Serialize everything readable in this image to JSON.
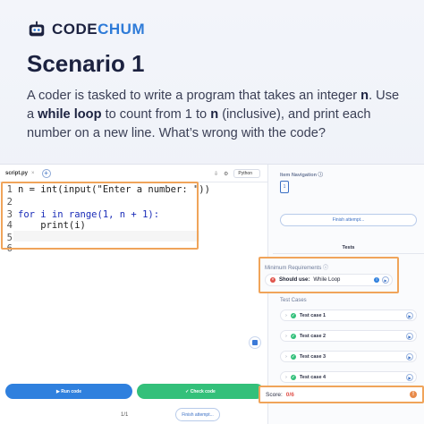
{
  "brand": {
    "name_part1": "CODE",
    "name_part2": "CHUM"
  },
  "headline": "Scenario 1",
  "description": {
    "p1": "A coder is tasked to write a program that takes an integer ",
    "b1": "n",
    "p2": ". Use a ",
    "b2": "while loop",
    "p3": " to count from 1 to ",
    "b3": "n",
    "p4": " (inclusive), and print each number on a new line. What’s wrong with the code?"
  },
  "editor": {
    "file_tab": "script.py",
    "close_glyph": "×",
    "add_glyph": "+",
    "language": "Python",
    "lines": [
      {
        "num": "1",
        "text": "n = int(input(\"Enter a number: \"))"
      },
      {
        "num": "2",
        "text": ""
      },
      {
        "num": "3",
        "text": "for i in range(1, n + 1):"
      },
      {
        "num": "4",
        "text": "    print(i)"
      },
      {
        "num": "5",
        "text": ""
      },
      {
        "num": "6",
        "text": ""
      }
    ]
  },
  "actions": {
    "run": "Run code",
    "check": "Check code",
    "pager": "1/1",
    "finish": "Finish attempt..."
  },
  "sidebar": {
    "nav_title": "Item Navigation",
    "nav_item": "1",
    "finish": "Finish attempt...",
    "tests_label": "Tests",
    "req_title": "Minimum Requirements",
    "req_item_prefix": "Should use:",
    "req_item_value": "While Loop",
    "tc_title": "Test Cases",
    "test_cases": [
      "Test case 1",
      "Test case 2",
      "Test case 3",
      "Test case 4"
    ],
    "score_label": "Score:",
    "score_value": "0/6"
  },
  "colors": {
    "accent": "#2f80de",
    "success": "#33c07a",
    "error": "#e0524a",
    "highlight": "#f0a45a"
  }
}
